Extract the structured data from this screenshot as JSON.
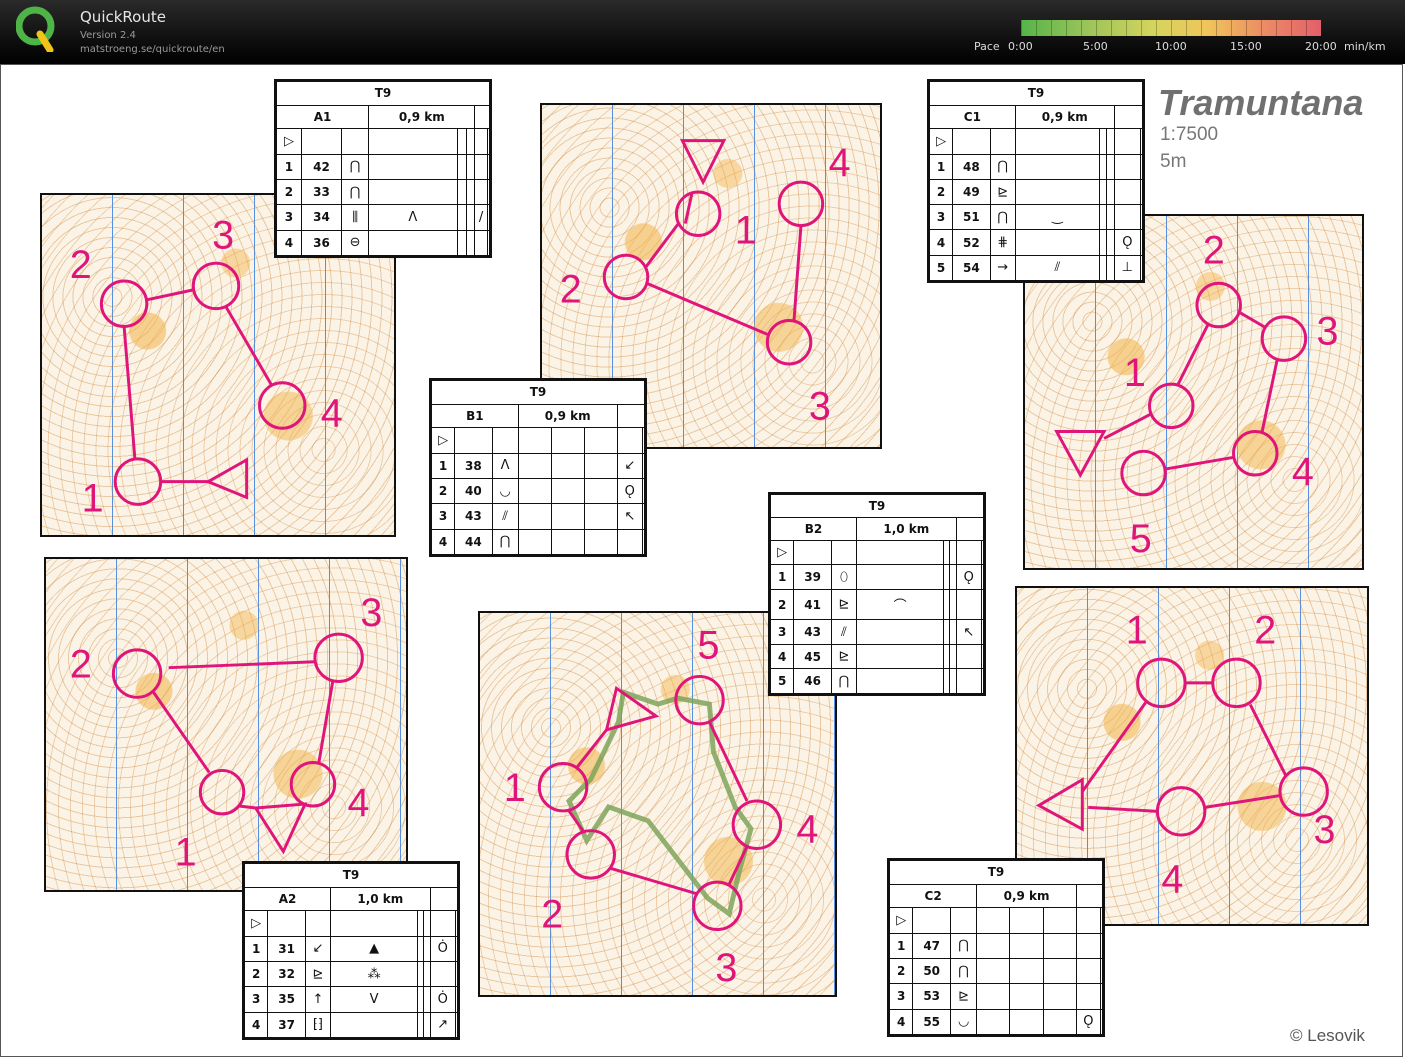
{
  "app": {
    "name": "QuickRoute",
    "version": "Version 2.4",
    "url": "matstroeng.se/quickroute/en"
  },
  "pace": {
    "label": "Pace",
    "ticks": [
      "0:00",
      "5:00",
      "10:00",
      "15:00",
      "20:00"
    ],
    "unit": "min/km"
  },
  "map_info": {
    "title": "Tramuntana",
    "scale": "1:7500",
    "equidistance": "5m",
    "copyright": "© Lesovik"
  },
  "colors": {
    "course": "#e0157a",
    "route": "#7fa35a"
  },
  "descriptions": {
    "A1": {
      "event": "T9",
      "code": "A1",
      "length": "0,9 km",
      "controls": [
        {
          "n": "1",
          "code": "42",
          "sym": [
            "⋂",
            "",
            "",
            "",
            "",
            ""
          ]
        },
        {
          "n": "2",
          "code": "33",
          "sym": [
            "⋂",
            "",
            "",
            "",
            "",
            ""
          ]
        },
        {
          "n": "3",
          "code": "34",
          "sym": [
            "⫼",
            "Λ",
            "",
            "",
            "/",
            ""
          ]
        },
        {
          "n": "4",
          "code": "36",
          "sym": [
            "⊖",
            "",
            "",
            "",
            "",
            ""
          ]
        }
      ]
    },
    "B1": {
      "event": "T9",
      "code": "B1",
      "length": "0,9 km",
      "controls": [
        {
          "n": "1",
          "code": "38",
          "sym": [
            "Λ",
            "",
            "",
            "",
            "↙",
            ""
          ]
        },
        {
          "n": "2",
          "code": "40",
          "sym": [
            "◡",
            "",
            "",
            "",
            "Ǫ",
            ""
          ]
        },
        {
          "n": "3",
          "code": "43",
          "sym": [
            "⫽",
            "",
            "",
            "",
            "↖",
            ""
          ]
        },
        {
          "n": "4",
          "code": "44",
          "sym": [
            "⋂",
            "",
            "",
            "",
            "",
            ""
          ]
        }
      ]
    },
    "C1": {
      "event": "T9",
      "code": "C1",
      "length": "0,9 km",
      "controls": [
        {
          "n": "1",
          "code": "48",
          "sym": [
            "⋂",
            "",
            "",
            "",
            "",
            ""
          ]
        },
        {
          "n": "2",
          "code": "49",
          "sym": [
            "⊵",
            "",
            "",
            "",
            "",
            ""
          ]
        },
        {
          "n": "3",
          "code": "51",
          "sym": [
            "⋂",
            "‿",
            "",
            "",
            "",
            ""
          ]
        },
        {
          "n": "4",
          "code": "52",
          "sym": [
            "⋕",
            "",
            "",
            "",
            "Ǫ",
            ""
          ]
        },
        {
          "n": "5",
          "code": "54",
          "sym": [
            "→",
            "⫽",
            "",
            "",
            "⊥",
            ""
          ]
        }
      ]
    },
    "B2": {
      "event": "T9",
      "code": "B2",
      "length": "1,0 km",
      "controls": [
        {
          "n": "1",
          "code": "39",
          "sym": [
            "⬯",
            "",
            "",
            "",
            "Ǫ",
            ""
          ]
        },
        {
          "n": "2",
          "code": "41",
          "sym": [
            "⊵",
            "⌒",
            "",
            "",
            "",
            ""
          ]
        },
        {
          "n": "3",
          "code": "43",
          "sym": [
            "⫽",
            "",
            "",
            "",
            "↖",
            ""
          ]
        },
        {
          "n": "4",
          "code": "45",
          "sym": [
            "⊵",
            "",
            "",
            "",
            "",
            ""
          ]
        },
        {
          "n": "5",
          "code": "46",
          "sym": [
            "⋂",
            "",
            "",
            "",
            "",
            ""
          ]
        }
      ]
    },
    "A2": {
      "event": "T9",
      "code": "A2",
      "length": "1,0 km",
      "controls": [
        {
          "n": "1",
          "code": "31",
          "sym": [
            "↙",
            "▲",
            "",
            "",
            "Ȯ",
            ""
          ]
        },
        {
          "n": "2",
          "code": "32",
          "sym": [
            "⊵",
            "⁂",
            "",
            "",
            "",
            ""
          ]
        },
        {
          "n": "3",
          "code": "35",
          "sym": [
            "↑",
            "V",
            "",
            "",
            "Ȯ",
            ""
          ]
        },
        {
          "n": "4",
          "code": "37",
          "sym": [
            "⁅⁆",
            "",
            "",
            "",
            "↗",
            ""
          ]
        }
      ]
    },
    "C2": {
      "event": "T9",
      "code": "C2",
      "length": "0,9 km",
      "controls": [
        {
          "n": "1",
          "code": "47",
          "sym": [
            "⋂",
            "",
            "",
            "",
            "",
            ""
          ]
        },
        {
          "n": "2",
          "code": "50",
          "sym": [
            "⋂",
            "",
            "",
            "",
            "",
            ""
          ]
        },
        {
          "n": "3",
          "code": "53",
          "sym": [
            "⊵",
            "",
            "",
            "",
            "",
            ""
          ]
        },
        {
          "n": "4",
          "code": "55",
          "sym": [
            "◡",
            "",
            "",
            "",
            "Ǫ",
            ""
          ]
        }
      ]
    }
  },
  "start_symbol": "▷"
}
